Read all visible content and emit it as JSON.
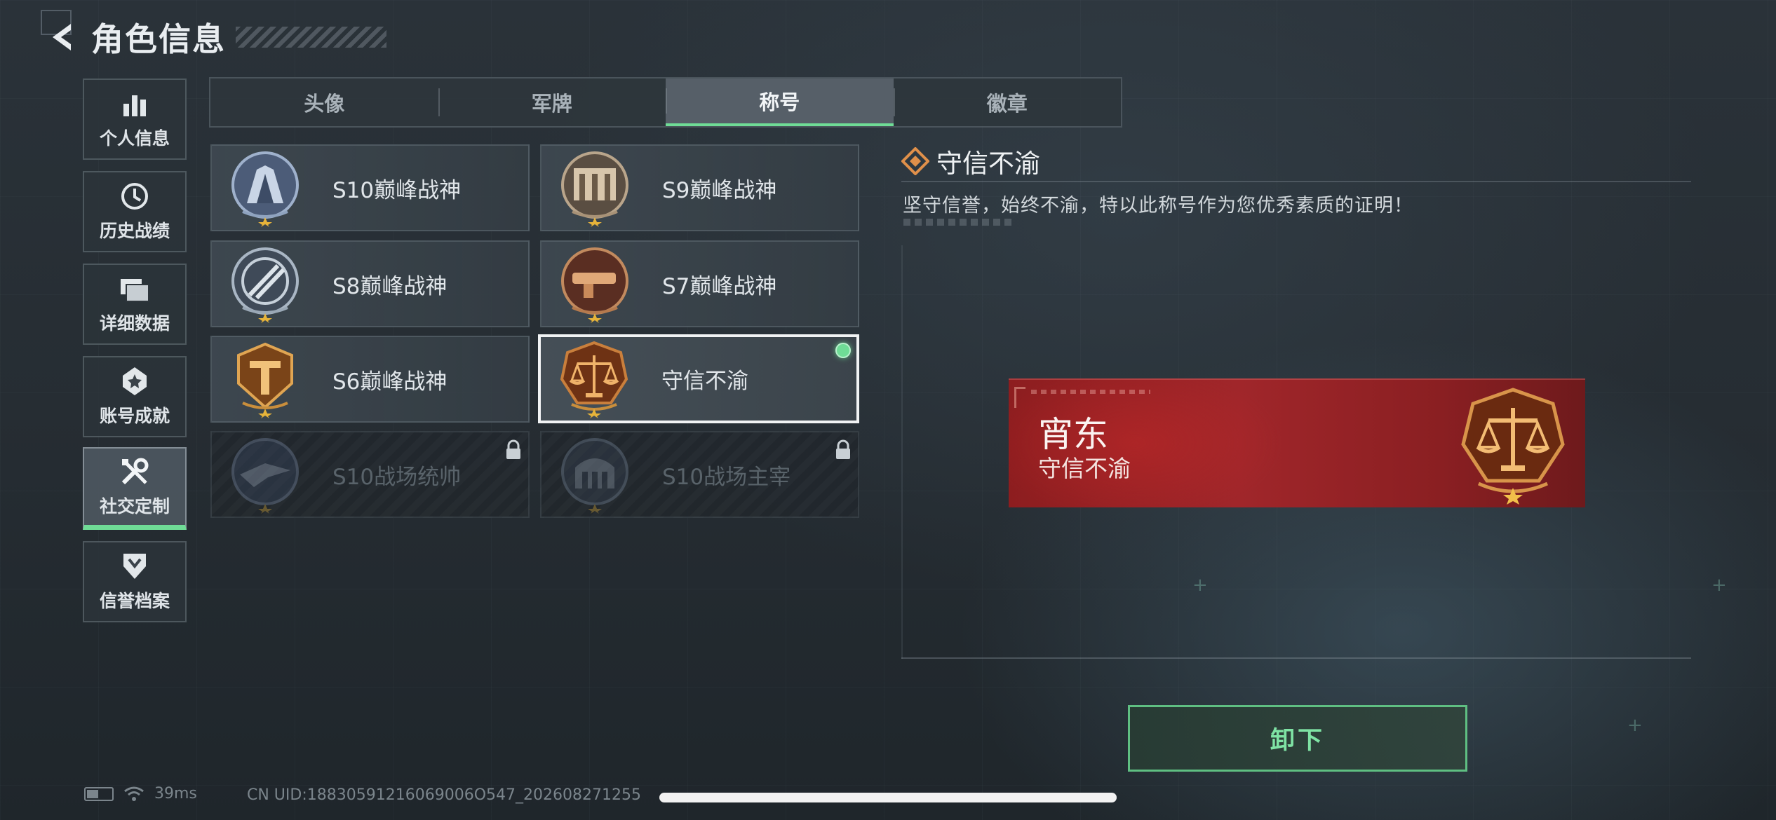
{
  "header": {
    "title": "角色信息",
    "back_icon": "back-arrow-icon"
  },
  "sidebar": {
    "items": [
      {
        "label": "个人信息",
        "icon": "bar-chart-icon",
        "active": false
      },
      {
        "label": "历史战绩",
        "icon": "clock-icon",
        "active": false
      },
      {
        "label": "详细数据",
        "icon": "folder-icon",
        "active": false
      },
      {
        "label": "账号成就",
        "icon": "achievement-icon",
        "active": false
      },
      {
        "label": "社交定制",
        "icon": "tools-icon",
        "active": true
      },
      {
        "label": "信誉档案",
        "icon": "credit-shield-icon",
        "active": false
      }
    ]
  },
  "tabs": [
    {
      "label": "头像",
      "active": false
    },
    {
      "label": "军牌",
      "active": false
    },
    {
      "label": "称号",
      "active": true
    },
    {
      "label": "徽章",
      "active": false
    }
  ],
  "titles": [
    {
      "name": "S10巅峰战神",
      "emblem": "s10-peak-emblem",
      "state": "owned"
    },
    {
      "name": "S9巅峰战神",
      "emblem": "s9-peak-emblem",
      "state": "owned"
    },
    {
      "name": "S8巅峰战神",
      "emblem": "s8-peak-emblem",
      "state": "owned"
    },
    {
      "name": "S7巅峰战神",
      "emblem": "s7-peak-emblem",
      "state": "owned"
    },
    {
      "name": "S6巅峰战神",
      "emblem": "s6-peak-emblem",
      "state": "owned"
    },
    {
      "name": "守信不渝",
      "emblem": "scales-emblem",
      "state": "equipped"
    },
    {
      "name": "S10战场统帅",
      "emblem": "s10-commander-emblem",
      "state": "locked"
    },
    {
      "name": "S10战场主宰",
      "emblem": "s10-dominator-emblem",
      "state": "locked"
    }
  ],
  "detail": {
    "title": "守信不渝",
    "description": "坚守信誉，始终不渝，特以此称号作为您优秀素质的证明！",
    "preview": {
      "player_name": "宵东",
      "title": "守信不渝"
    },
    "button_label": "卸下"
  },
  "status_bar": {
    "ping": "39ms",
    "uid": "CN UID:18830591216069006O547_202608271255"
  },
  "colors": {
    "accent_green": "#6fdc96",
    "banner_red": "#a0262a",
    "emblem_bronze": "#b8732e"
  }
}
